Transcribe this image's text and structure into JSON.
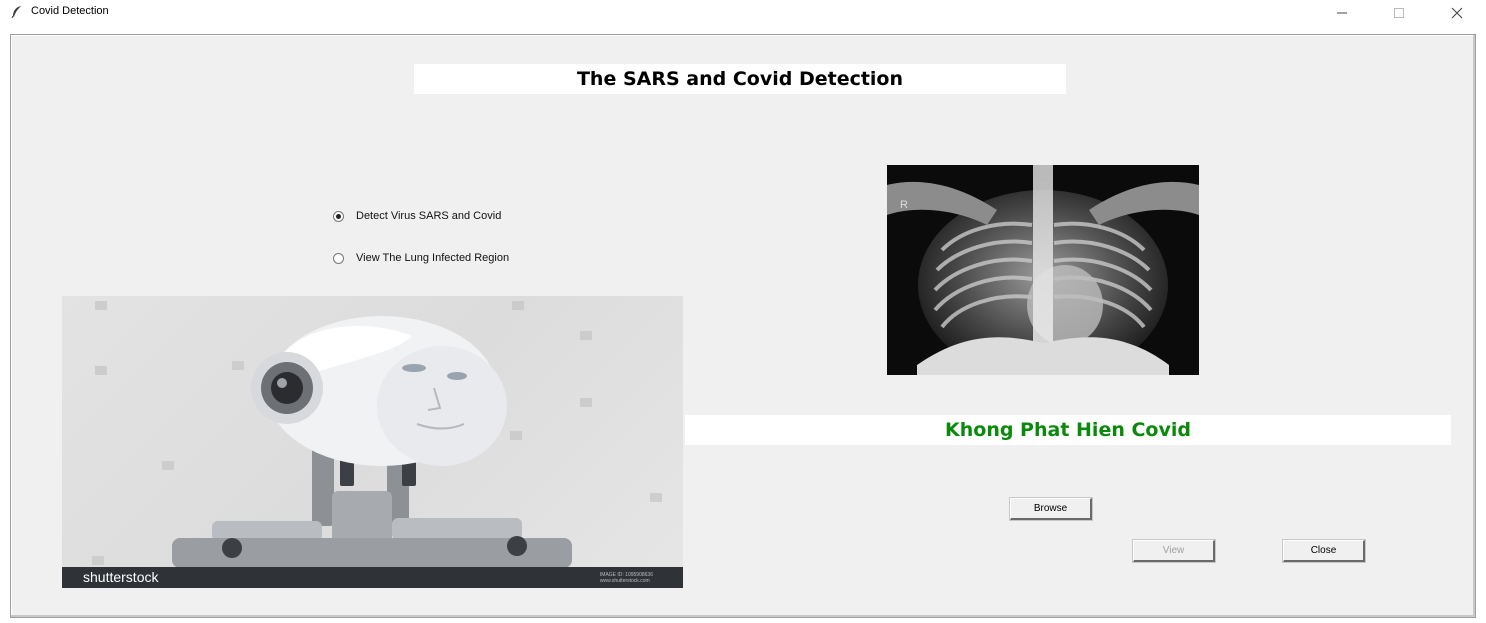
{
  "window": {
    "title": "Covid Detection"
  },
  "heading": "The SARS and Covid Detection",
  "options": [
    {
      "label": "Detect Virus SARS and Covid",
      "checked": true
    },
    {
      "label": "View The Lung Infected Region",
      "checked": false
    }
  ],
  "robot_image": {
    "watermark": "shutterstock",
    "footer_brand": "shutterstock",
    "footer_small_1": "IMAGE ID: 1095908636",
    "footer_small_2": "www.shutterstock.com"
  },
  "xray_image": {
    "marker": "R"
  },
  "result": {
    "text": "Khong Phat Hien Covid",
    "color": "#0a8a0a"
  },
  "buttons": {
    "browse": "Browse",
    "view": "View",
    "close": "Close"
  }
}
